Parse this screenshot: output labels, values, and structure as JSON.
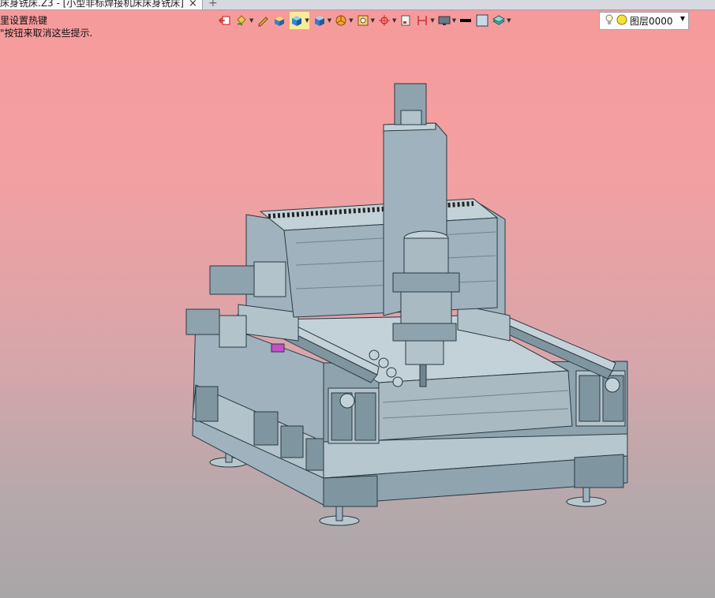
{
  "tabs": {
    "active_title": "床身铣床.Z3 - [小型非标焊接机床床身铣床]",
    "close_glyph": "×",
    "new_tab_glyph": "+"
  },
  "hints": {
    "line1": "里设置热键",
    "line2": "\"按钮来取消这些提示."
  },
  "toolbar": {
    "tools": [
      {
        "name": "exit-icon",
        "dropdown": false
      },
      {
        "name": "paint-bucket-icon",
        "dropdown": true
      },
      {
        "name": "pencil-icon",
        "dropdown": false
      },
      {
        "name": "box-solid-icon",
        "dropdown": false
      },
      {
        "name": "shaded-cube-icon",
        "dropdown": true,
        "active": true
      },
      {
        "name": "render-cube-icon",
        "dropdown": true
      },
      {
        "name": "pie-filter-icon",
        "dropdown": true
      },
      {
        "name": "view-frame-icon",
        "dropdown": true
      },
      {
        "name": "snap-target-icon",
        "dropdown": true
      },
      {
        "name": "sheet-icon",
        "dropdown": false
      },
      {
        "name": "dimension-icon",
        "dropdown": true
      },
      {
        "name": "display-icon",
        "dropdown": true
      },
      {
        "name": "line-black-icon",
        "dropdown": false
      },
      {
        "name": "color-swatch-icon",
        "dropdown": false
      },
      {
        "name": "layers-icon",
        "dropdown": true
      }
    ]
  },
  "layer": {
    "value": "图层0000",
    "arrow": "▼"
  },
  "colors": {
    "steel": "#9fb2bd",
    "steel_dark": "#6f848f",
    "steel_light": "#c3d1d8",
    "accent_magenta": "#c44fc8"
  }
}
